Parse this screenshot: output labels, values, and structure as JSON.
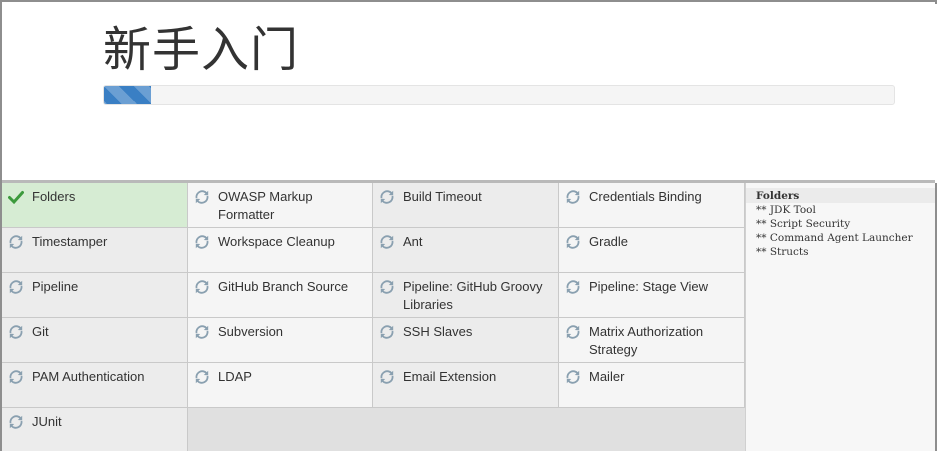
{
  "header": {
    "title": "新手入门",
    "progress_percent": 6
  },
  "plugins": [
    {
      "label": "Folders",
      "status": "done",
      "icon": "checkmark-icon"
    },
    {
      "label": "OWASP Markup Formatter",
      "status": "pending",
      "icon": "refresh-icon"
    },
    {
      "label": "Build Timeout",
      "status": "pending",
      "icon": "refresh-icon"
    },
    {
      "label": "Credentials Binding",
      "status": "pending",
      "icon": "refresh-icon"
    },
    {
      "label": "Timestamper",
      "status": "pending",
      "icon": "refresh-icon"
    },
    {
      "label": "Workspace Cleanup",
      "status": "pending",
      "icon": "refresh-icon"
    },
    {
      "label": "Ant",
      "status": "pending",
      "icon": "refresh-icon"
    },
    {
      "label": "Gradle",
      "status": "pending",
      "icon": "refresh-icon"
    },
    {
      "label": "Pipeline",
      "status": "pending",
      "icon": "refresh-icon"
    },
    {
      "label": "GitHub Branch Source",
      "status": "pending",
      "icon": "refresh-icon"
    },
    {
      "label": "Pipeline: GitHub Groovy Libraries",
      "status": "pending",
      "icon": "refresh-icon"
    },
    {
      "label": "Pipeline: Stage View",
      "status": "pending",
      "icon": "refresh-icon"
    },
    {
      "label": "Git",
      "status": "pending",
      "icon": "refresh-icon"
    },
    {
      "label": "Subversion",
      "status": "pending",
      "icon": "refresh-icon"
    },
    {
      "label": "SSH Slaves",
      "status": "pending",
      "icon": "refresh-icon"
    },
    {
      "label": "Matrix Authorization Strategy",
      "status": "pending",
      "icon": "refresh-icon"
    },
    {
      "label": "PAM Authentication",
      "status": "pending",
      "icon": "refresh-icon"
    },
    {
      "label": "LDAP",
      "status": "pending",
      "icon": "refresh-icon"
    },
    {
      "label": "Email Extension",
      "status": "pending",
      "icon": "refresh-icon"
    },
    {
      "label": "Mailer",
      "status": "pending",
      "icon": "refresh-icon"
    },
    {
      "label": "JUnit",
      "status": "pending",
      "icon": "refresh-icon"
    }
  ],
  "log": {
    "current": "Folders",
    "lines": [
      "** JDK Tool",
      "** Script Security",
      "** Command Agent Launcher",
      "** Structs"
    ]
  },
  "colors": {
    "accent": "#3a7fc4",
    "done_bg": "#d6ecd3",
    "check": "#3c9a3c",
    "spinner": "#8aa0b0"
  }
}
